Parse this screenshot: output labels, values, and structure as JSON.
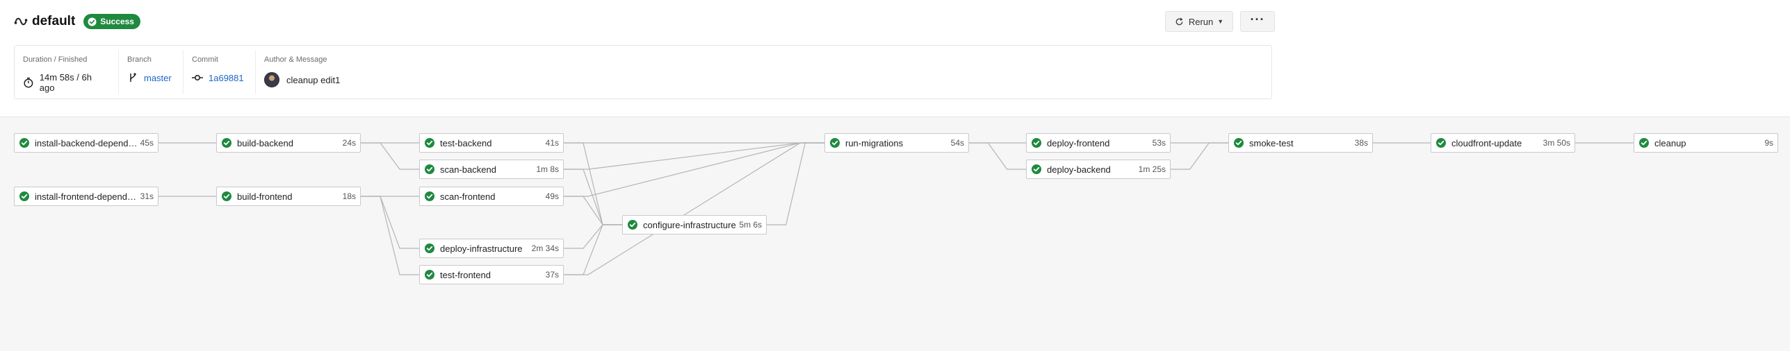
{
  "header": {
    "title": "default",
    "status_badge": "Success",
    "rerun_label": "Rerun",
    "more_label": "···"
  },
  "info": {
    "duration": {
      "label": "Duration / Finished",
      "value": "14m 58s / 6h ago"
    },
    "branch": {
      "label": "Branch",
      "value": "master"
    },
    "commit": {
      "label": "Commit",
      "value": "1a69881"
    },
    "author": {
      "label": "Author & Message",
      "value": "cleanup edit1"
    }
  },
  "colors": {
    "success": "#1f8a3f",
    "link": "#1b66c9"
  },
  "jobs": [
    {
      "name": "install-backend-dependen…",
      "duration": "45s",
      "status": "success"
    },
    {
      "name": "install-frontend-dependen…",
      "duration": "31s",
      "status": "success"
    },
    {
      "name": "build-backend",
      "duration": "24s",
      "status": "success"
    },
    {
      "name": "build-frontend",
      "duration": "18s",
      "status": "success"
    },
    {
      "name": "test-backend",
      "duration": "41s",
      "status": "success"
    },
    {
      "name": "scan-backend",
      "duration": "1m 8s",
      "status": "success"
    },
    {
      "name": "scan-frontend",
      "duration": "49s",
      "status": "success"
    },
    {
      "name": "deploy-infrastructure",
      "duration": "2m 34s",
      "status": "success"
    },
    {
      "name": "test-frontend",
      "duration": "37s",
      "status": "success"
    },
    {
      "name": "configure-infrastructure",
      "duration": "5m 6s",
      "status": "success"
    },
    {
      "name": "run-migrations",
      "duration": "54s",
      "status": "success"
    },
    {
      "name": "deploy-frontend",
      "duration": "53s",
      "status": "success"
    },
    {
      "name": "deploy-backend",
      "duration": "1m 25s",
      "status": "success"
    },
    {
      "name": "smoke-test",
      "duration": "38s",
      "status": "success"
    },
    {
      "name": "cloudfront-update",
      "duration": "3m 50s",
      "status": "success"
    },
    {
      "name": "cleanup",
      "duration": "9s",
      "status": "success"
    }
  ],
  "dependencies": [
    [
      "install-backend-dependen…",
      "build-backend"
    ],
    [
      "install-frontend-dependen…",
      "build-frontend"
    ],
    [
      "build-backend",
      "test-backend"
    ],
    [
      "build-backend",
      "scan-backend"
    ],
    [
      "build-frontend",
      "scan-frontend"
    ],
    [
      "build-frontend",
      "deploy-infrastructure"
    ],
    [
      "build-frontend",
      "test-frontend"
    ],
    [
      "test-backend",
      "configure-infrastructure"
    ],
    [
      "scan-backend",
      "configure-infrastructure"
    ],
    [
      "scan-frontend",
      "configure-infrastructure"
    ],
    [
      "deploy-infrastructure",
      "configure-infrastructure"
    ],
    [
      "test-frontend",
      "configure-infrastructure"
    ],
    [
      "test-backend",
      "run-migrations"
    ],
    [
      "scan-backend",
      "run-migrations"
    ],
    [
      "scan-frontend",
      "run-migrations"
    ],
    [
      "configure-infrastructure",
      "run-migrations"
    ],
    [
      "test-frontend",
      "run-migrations"
    ],
    [
      "run-migrations",
      "deploy-frontend"
    ],
    [
      "run-migrations",
      "deploy-backend"
    ],
    [
      "deploy-frontend",
      "smoke-test"
    ],
    [
      "deploy-backend",
      "smoke-test"
    ],
    [
      "smoke-test",
      "cloudfront-update"
    ],
    [
      "cloudfront-update",
      "cleanup"
    ]
  ]
}
